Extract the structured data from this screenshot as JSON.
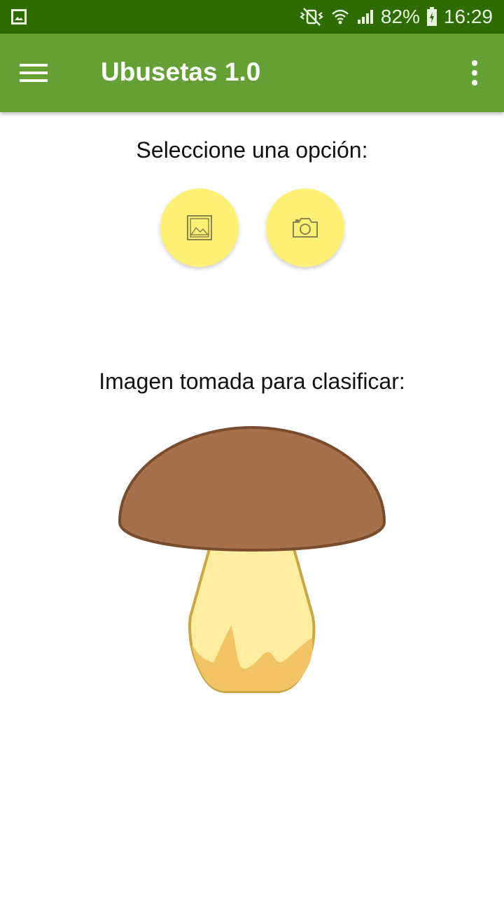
{
  "status_bar": {
    "battery": "82%",
    "time": "16:29",
    "icons": [
      "gallery-notification-icon",
      "mute-vibrate-icon",
      "wifi-icon",
      "signal-icon",
      "battery-charging-icon"
    ]
  },
  "app_bar": {
    "title": "Ubusetas 1.0",
    "icons": [
      "hamburger-menu-icon",
      "more-vert-icon"
    ]
  },
  "main": {
    "select_heading": "Seleccione una opción:",
    "buttons": [
      {
        "name": "gallery-button",
        "icon": "image-icon"
      },
      {
        "name": "camera-button",
        "icon": "camera-icon"
      }
    ],
    "image_heading": "Imagen tomada para clasificar:",
    "image": {
      "name": "mushroom-illustration"
    }
  },
  "colors": {
    "status_bar": "#2e6b00",
    "app_bar": "#659f35",
    "fab": "#fff176",
    "mushroom_cap": "#a5704a",
    "mushroom_stem": "#ffee9f"
  }
}
